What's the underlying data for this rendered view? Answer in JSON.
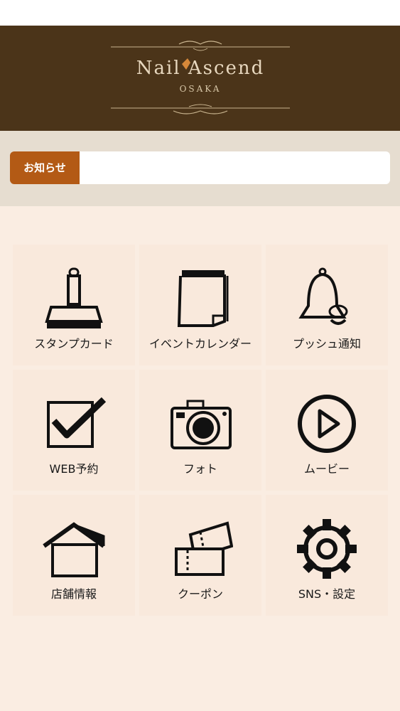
{
  "header": {
    "logo_title": "Nail Ascend",
    "logo_subtitle": "OSAKA"
  },
  "notice": {
    "label": "お知らせ",
    "text": ""
  },
  "menu": [
    {
      "label": "スタンプカード",
      "icon": "stamp-icon"
    },
    {
      "label": "イベントカレンダー",
      "icon": "calendar-icon"
    },
    {
      "label": "プッシュ通知",
      "icon": "bell-icon"
    },
    {
      "label": "WEB予約",
      "icon": "checkbox-icon"
    },
    {
      "label": "フォト",
      "icon": "camera-icon"
    },
    {
      "label": "ムービー",
      "icon": "play-icon"
    },
    {
      "label": "店舗情報",
      "icon": "house-icon"
    },
    {
      "label": "クーポン",
      "icon": "coupon-icon"
    },
    {
      "label": "SNS・設定",
      "icon": "gear-icon"
    }
  ],
  "colors": {
    "header_bg": "#4b3419",
    "notice_label_bg": "#b35a15",
    "page_bg": "#faede2"
  }
}
